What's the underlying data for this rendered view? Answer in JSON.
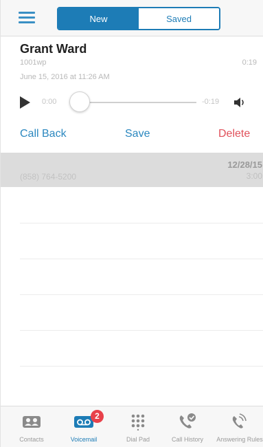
{
  "header": {
    "tabs": [
      {
        "label": "New",
        "active": true
      },
      {
        "label": "Saved",
        "active": false
      }
    ]
  },
  "voicemail": {
    "caller_name": "Grant Ward",
    "caller_number": "1001wp",
    "duration": "0:19",
    "date": "June 15, 2016 at 11:26 AM",
    "player": {
      "elapsed": "0:00",
      "remaining": "-0:19",
      "progress": 0
    },
    "actions": {
      "call_back": "Call Back",
      "save": "Save",
      "delete": "Delete"
    }
  },
  "list": {
    "items": [
      {
        "number": "(858) 764-5200",
        "date": "12/28/15",
        "time": "3:00"
      }
    ]
  },
  "tabbar": {
    "tabs": [
      {
        "label": "Contacts",
        "icon": "contacts-icon",
        "active": false
      },
      {
        "label": "Voicemail",
        "icon": "voicemail-icon",
        "active": true,
        "badge": "2"
      },
      {
        "label": "Dial Pad",
        "icon": "dialpad-icon",
        "active": false
      },
      {
        "label": "Call History",
        "icon": "call-history-icon",
        "active": false
      },
      {
        "label": "Answering Rules",
        "icon": "answering-rules-icon",
        "active": false
      }
    ]
  },
  "colors": {
    "accent": "#1d7cb6",
    "link": "#2a87bf",
    "delete": "#e0505a",
    "badge": "#e8414a"
  }
}
